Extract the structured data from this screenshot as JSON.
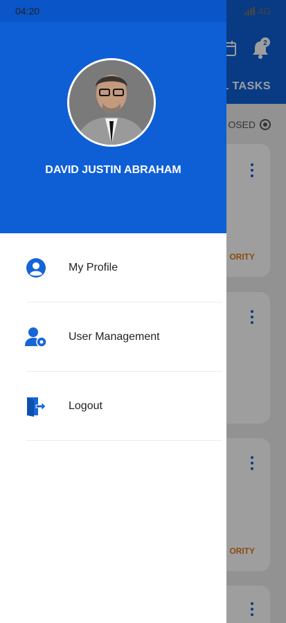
{
  "status_bar": {
    "time": "04:20",
    "network": "4G"
  },
  "background": {
    "tabs_label": "L TASKS",
    "filter_label": "OSED",
    "notification_count": "2",
    "priority_label": "ORITY"
  },
  "drawer": {
    "user_name": "DAVID JUSTIN ABRAHAM",
    "menu": [
      {
        "label": "My Profile",
        "icon": "profile-icon"
      },
      {
        "label": "User Management",
        "icon": "user-management-icon"
      },
      {
        "label": "Logout",
        "icon": "logout-icon"
      }
    ]
  },
  "colors": {
    "primary": "#0e5fd6",
    "accent": "#e07a1a"
  }
}
